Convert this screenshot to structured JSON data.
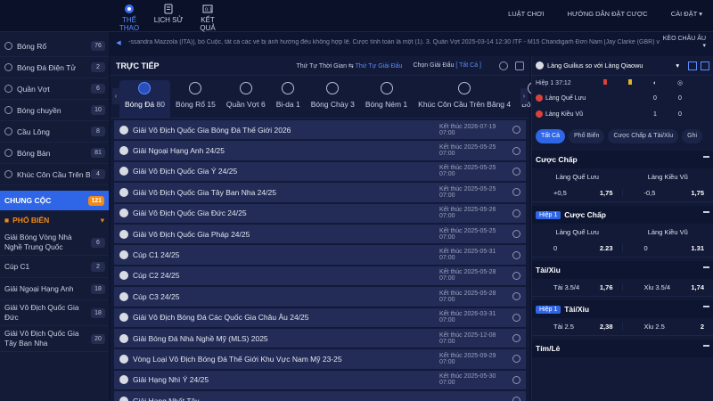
{
  "topnav": {
    "items": [
      {
        "label": "THỂ THAO",
        "icon": "soccer-ball-icon"
      },
      {
        "label": "LỊCH SỬ",
        "icon": "document-icon"
      },
      {
        "label": "KẾT QUẢ",
        "icon": "scoreboard-icon"
      }
    ],
    "right": [
      "LUẬT CHƠI",
      "HƯỚNG DẪN ĐẶT CƯỢC",
      "CÀI ĐẶT"
    ]
  },
  "sidebar": {
    "sports": [
      {
        "label": "Bóng Rổ",
        "count": "76"
      },
      {
        "label": "Bóng Đá Điện Tử",
        "count": "2"
      },
      {
        "label": "Quần Vợt",
        "count": "6"
      },
      {
        "label": "Bóng chuyền",
        "count": "10"
      },
      {
        "label": "Cầu Lông",
        "count": "8"
      },
      {
        "label": "Bóng Bàn",
        "count": "81"
      },
      {
        "label": "Khúc Côn Cầu Trên Băng",
        "count": "4"
      }
    ],
    "champion": {
      "label": "CHUNG CỘC",
      "count": "121"
    },
    "popular_label": "PHỔ BIẾN",
    "leagues": [
      {
        "label": "Giải Bóng Vòng Nhà Nghề Trung Quốc",
        "count": "6"
      },
      {
        "label": "Cúp C1",
        "count": "2"
      },
      {
        "label": "Giải Ngoại Hạng Anh",
        "count": "18"
      },
      {
        "label": "Giải Vô Địch Quốc Gia Đức",
        "count": "18"
      },
      {
        "label": "Giải Vô Địch Quốc Gia Tây Ban Nha",
        "count": "20"
      }
    ]
  },
  "ticker": {
    "text": "-ssandra Mazzola (ITA)], bỏ Cuộc, tất cả các vé bị ảnh hưởng đều không hợp lệ. Cược tính toán là một (1). 3. Quần Vợt 2025-03-14 12:30 ITF - M15 Chandigarh Đơn Nam [Jay Clarke (GBR) vs Madhwin Ka",
    "right": "KÈO CHÂU ÂU"
  },
  "center": {
    "title": "TRỰC TIẾP",
    "sort_label": "Thứ Tự Thời Gian",
    "sort_sep": "⇆",
    "sort_active": "Thứ Tự Giải Đấu",
    "filter_label": "Chọn Giải Đấu",
    "filter_value": "[ Tất Cả ]",
    "sport_tabs": [
      {
        "label": "Bóng Đá",
        "count": "80",
        "active": true
      },
      {
        "label": "Bóng Rổ",
        "count": "15"
      },
      {
        "label": "Quần Vợt",
        "count": "6"
      },
      {
        "label": "Bi-da",
        "count": "1"
      },
      {
        "label": "Bóng Chày",
        "count": "3"
      },
      {
        "label": "Bóng Ném",
        "count": "1"
      },
      {
        "label": "Khúc Côn Cầu Trên Băng",
        "count": "4"
      },
      {
        "label": "Bóng B",
        "count": ""
      }
    ],
    "matches": [
      {
        "name": "Giải Vô Địch Quốc Gia Bóng Đá Thế Giới 2026",
        "end": "Kết thúc 2026-07-19 07:00"
      },
      {
        "name": "Giải Ngoại Hạng Anh 24/25",
        "end": "Kết thúc 2025-05-25 07:00"
      },
      {
        "name": "Giải Vô Địch Quốc Gia Ý 24/25",
        "end": "Kết thúc 2025-05-25 07:00"
      },
      {
        "name": "Giải Vô Địch Quốc Gia Tây Ban Nha 24/25",
        "end": "Kết thúc 2025-05-25 07:00"
      },
      {
        "name": "Giải Vô Địch Quốc Gia Đức 24/25",
        "end": "Kết thúc 2025-05-26 07:00"
      },
      {
        "name": "Giải Vô Địch Quốc Gia Pháp 24/25",
        "end": "Kết thúc 2025-05-25 07:00"
      },
      {
        "name": "Cúp C1 24/25",
        "end": "Kết thúc 2025-05-31 07:00"
      },
      {
        "name": "Cúp C2 24/25",
        "end": "Kết thúc 2025-05-28 07:00"
      },
      {
        "name": "Cúp C3 24/25",
        "end": "Kết thúc 2025-05-28 07:00"
      },
      {
        "name": "Giải Vô Địch Bóng Đá Các Quốc Gia Châu Âu 24/25",
        "end": "Kết thúc 2026-03-31 07:00"
      },
      {
        "name": "Giải Bóng Đá Nhà Nghề Mỹ (MLS) 2025",
        "end": "Kết thúc 2025-12-08 07:00"
      },
      {
        "name": "Vòng Loại Vô Địch Bóng Đá Thế Giới Khu Vực Nam Mỹ 23-25",
        "end": "Kết thúc 2025-09-29 07:00"
      },
      {
        "name": "Giải Hạng Nhì Ý 24/25",
        "end": "Kết thúc 2025-05-30 07:00"
      },
      {
        "name": "Giải Hạng Nhất Tây...",
        "end": ""
      }
    ]
  },
  "right": {
    "match_title": "Làng Guilius so với Làng Qiaowu",
    "score_half": "Hiệp 1 37:12",
    "teams": [
      {
        "name": "Làng Quế Lưu",
        "c1": "0",
        "c2": "0"
      },
      {
        "name": "Làng Kiều Vũ",
        "c1": "1",
        "c2": "0"
      }
    ],
    "tabs": [
      "Tất Cả",
      "Phổ Biến",
      "Cược Chấp & Tài/Xỉu",
      "Ghi"
    ],
    "markets": [
      {
        "title": "Cược Chấp",
        "half": "",
        "team_left": "Làng Quế Lưu",
        "team_right": "Làng Kiều Vũ",
        "left_line": "+0,5",
        "left_odds": "1,75",
        "right_line": "-0,5",
        "right_odds": "1,75"
      },
      {
        "title": "Cược Chấp",
        "half": "Hiệp 1",
        "team_left": "Làng Quế Lưu",
        "team_right": "Làng Kiều Vũ",
        "left_line": "0",
        "left_odds": "2.23",
        "right_line": "0",
        "right_odds": "1.31"
      },
      {
        "title": "Tài/Xỉu",
        "half": "",
        "team_left": "",
        "team_right": "",
        "left_line": "Tài 3.5/4",
        "left_odds": "1,76",
        "right_line": "Xỉu 3.5/4",
        "right_odds": "1,74"
      },
      {
        "title": "Tài/Xỉu",
        "half": "Hiệp 1",
        "team_left": "",
        "team_right": "",
        "left_line": "Tài 2.5",
        "left_odds": "2,38",
        "right_line": "Xỉu 2.5",
        "right_odds": "2"
      },
      {
        "title": "Tím/Lẻ",
        "half": "",
        "team_left": "",
        "team_right": "",
        "left_line": "",
        "left_odds": "",
        "right_line": "",
        "right_odds": ""
      }
    ]
  }
}
